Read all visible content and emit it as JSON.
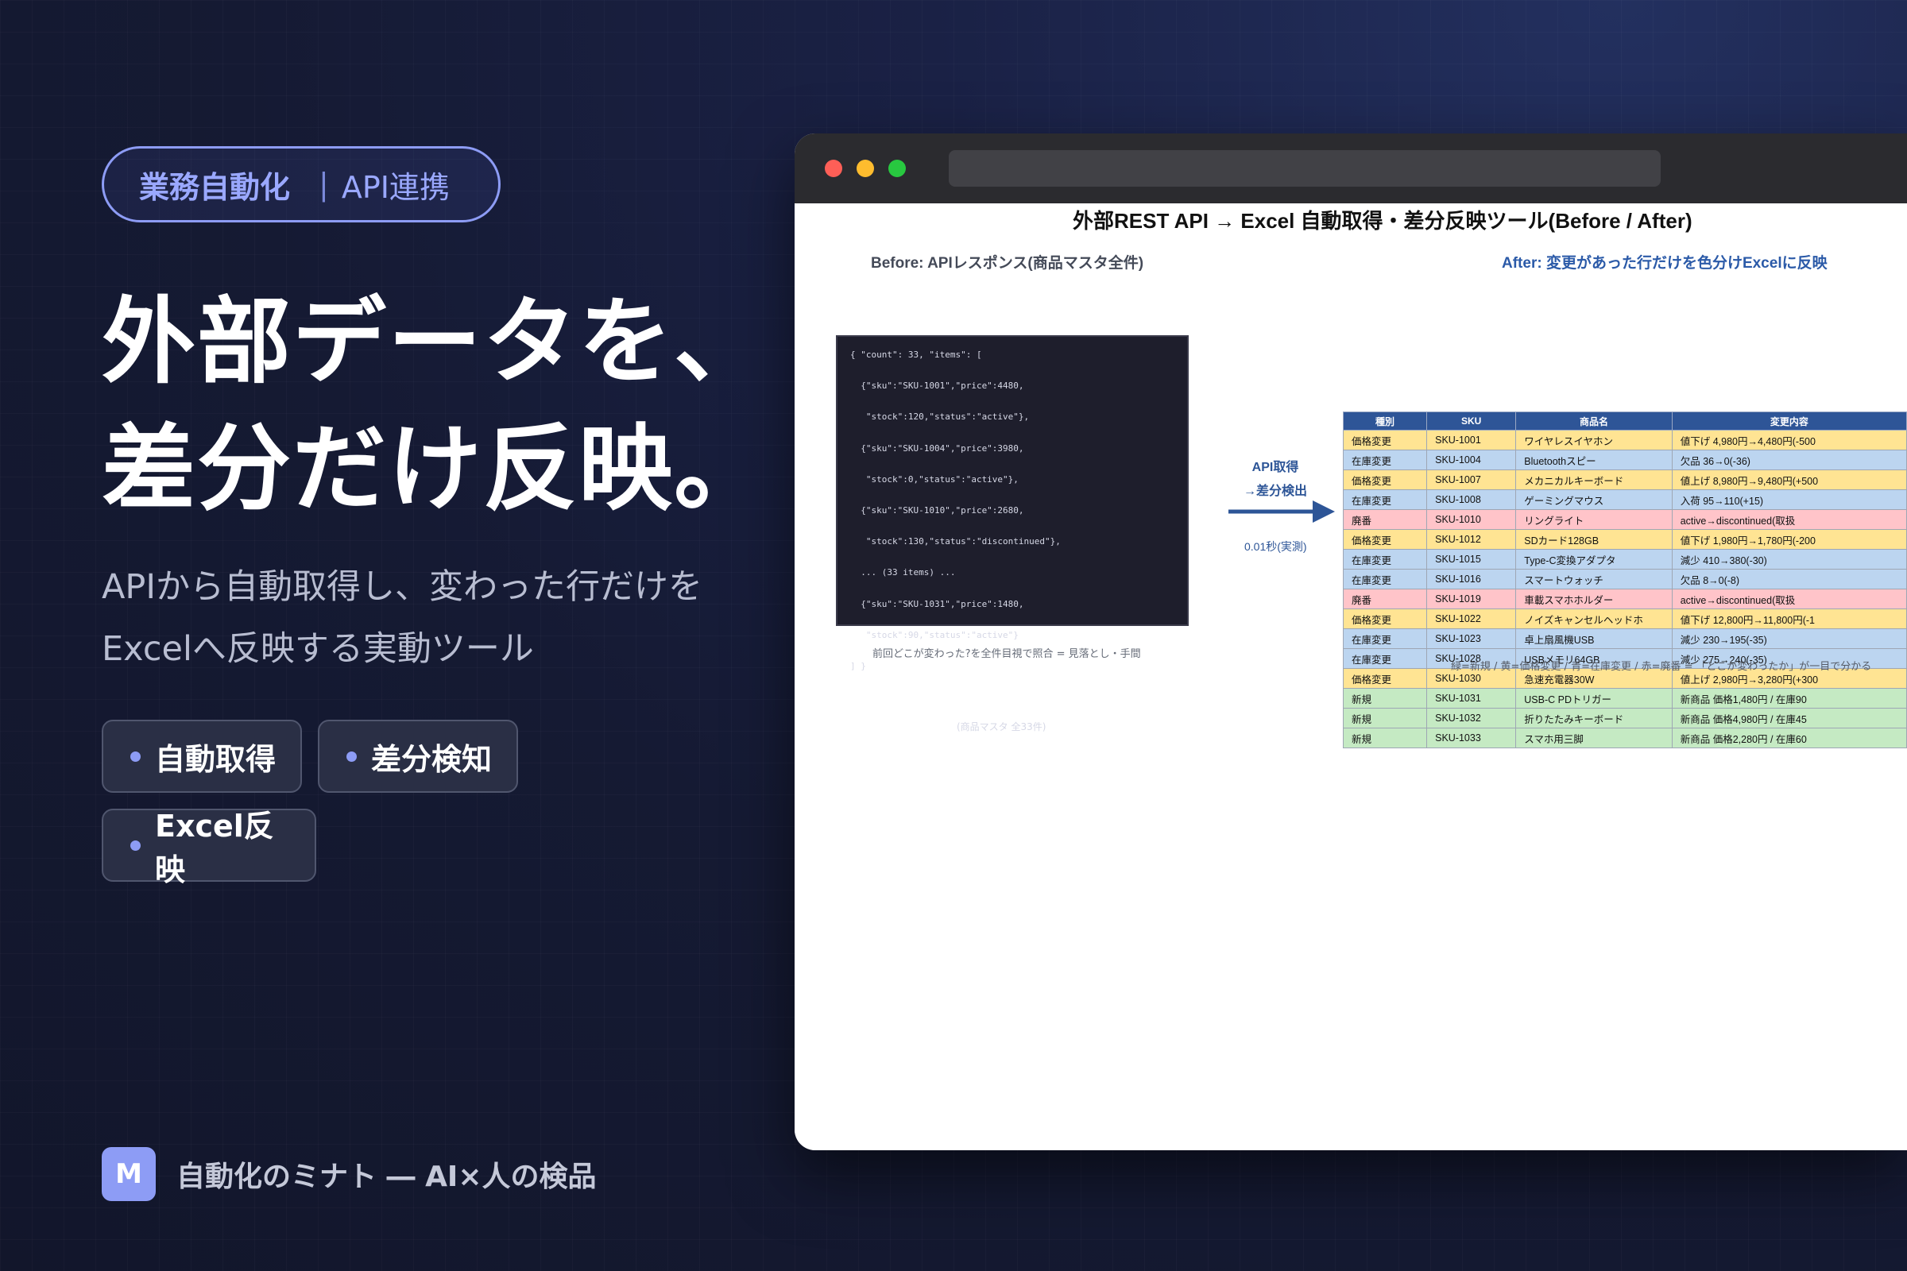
{
  "category": {
    "primary": "業務自動化",
    "secondary": "API連携"
  },
  "headline": {
    "line1": "外部データを、",
    "line2": "差分だけ反映。"
  },
  "subtitle": {
    "line1": "APIから自動取得し、変わった行だけを",
    "line2": "Excelへ反映する実動ツール"
  },
  "tags": [
    "自動取得",
    "差分検知",
    "Excel反映"
  ],
  "brand": {
    "logo_letter": "M",
    "text": "自動化のミナト ― AI×人の検品"
  },
  "colors": {
    "accent": "#8d9cf5",
    "header_blue": "#2e5597",
    "price": "#ffe493",
    "stock": "#bcd5f0",
    "discontinued": "#ffc4c9",
    "new": "#c5eac3"
  },
  "document": {
    "title": "外部REST API → Excel 自動取得・差分反映ツール(Before / After)",
    "before_label": "Before: APIレスポンス(商品マスタ全件)",
    "after_label": "After: 変更があった行だけを色分けExcelに反映",
    "code_lines": [
      "{ \"count\": 33, \"items\": [",
      "  {\"sku\":\"SKU-1001\",\"price\":4480,",
      "   \"stock\":120,\"status\":\"active\"},",
      "  {\"sku\":\"SKU-1004\",\"price\":3980,",
      "   \"stock\":0,\"status\":\"active\"},",
      "  {\"sku\":\"SKU-1010\",\"price\":2680,",
      "   \"stock\":130,\"status\":\"discontinued\"},",
      "  ... (33 items) ...",
      "  {\"sku\":\"SKU-1031\",\"price\":1480,",
      "   \"stock\":90,\"status\":\"active\"}",
      "] }"
    ],
    "code_note": "(商品マスタ 全33件)",
    "before_caption": "前回どこが変わった?を全件目視で照合 = 見落とし・手間",
    "arrow_label_1": "API取得",
    "arrow_label_2": "→差分検出",
    "arrow_time": "0.01秒(実測)",
    "table": {
      "headers": [
        "種別",
        "SKU",
        "商品名",
        "変更内容"
      ],
      "rows": [
        {
          "kind": "price",
          "cells": [
            "価格変更",
            "SKU-1001",
            "ワイヤレスイヤホン",
            "値下げ 4,980円→4,480円(-500"
          ]
        },
        {
          "kind": "stock",
          "cells": [
            "在庫変更",
            "SKU-1004",
            "Bluetoothスピー",
            "欠品 36→0(-36)"
          ]
        },
        {
          "kind": "price",
          "cells": [
            "価格変更",
            "SKU-1007",
            "メカニカルキーボード",
            "値上げ 8,980円→9,480円(+500"
          ]
        },
        {
          "kind": "stock",
          "cells": [
            "在庫変更",
            "SKU-1008",
            "ゲーミングマウス",
            "入荷 95→110(+15)"
          ]
        },
        {
          "kind": "disc",
          "cells": [
            "廃番",
            "SKU-1010",
            "リングライト",
            "active→discontinued(取扱"
          ]
        },
        {
          "kind": "price",
          "cells": [
            "価格変更",
            "SKU-1012",
            "SDカード128GB",
            "値下げ 1,980円→1,780円(-200"
          ]
        },
        {
          "kind": "stock",
          "cells": [
            "在庫変更",
            "SKU-1015",
            "Type-C変換アダプタ",
            "減少 410→380(-30)"
          ]
        },
        {
          "kind": "stock",
          "cells": [
            "在庫変更",
            "SKU-1016",
            "スマートウォッチ",
            "欠品 8→0(-8)"
          ]
        },
        {
          "kind": "disc",
          "cells": [
            "廃番",
            "SKU-1019",
            "車載スマホホルダー",
            "active→discontinued(取扱"
          ]
        },
        {
          "kind": "price",
          "cells": [
            "価格変更",
            "SKU-1022",
            "ノイズキャンセルヘッドホ",
            "値下げ 12,800円→11,800円(-1"
          ]
        },
        {
          "kind": "stock",
          "cells": [
            "在庫変更",
            "SKU-1023",
            "卓上扇風機USB",
            "減少 230→195(-35)"
          ]
        },
        {
          "kind": "stock",
          "cells": [
            "在庫変更",
            "SKU-1028",
            "USBメモリ64GB",
            "減少 275→240(-35)"
          ]
        },
        {
          "kind": "price",
          "cells": [
            "価格変更",
            "SKU-1030",
            "急速充電器30W",
            "値上げ 2,980円→3,280円(+300"
          ]
        },
        {
          "kind": "new",
          "cells": [
            "新規",
            "SKU-1031",
            "USB-C PDトリガー",
            "新商品 価格1,480円 / 在庫90"
          ]
        },
        {
          "kind": "new",
          "cells": [
            "新規",
            "SKU-1032",
            "折りたたみキーボード",
            "新商品 価格4,980円 / 在庫45"
          ]
        },
        {
          "kind": "new",
          "cells": [
            "新規",
            "SKU-1033",
            "スマホ用三脚",
            "新商品 価格2,280円 / 在庫60"
          ]
        }
      ]
    },
    "after_caption": "緑=新規 / 黄=価格変更 / 青=在庫変更 / 赤=廃番 = 「どこが変わったか」が一目で分かる"
  }
}
